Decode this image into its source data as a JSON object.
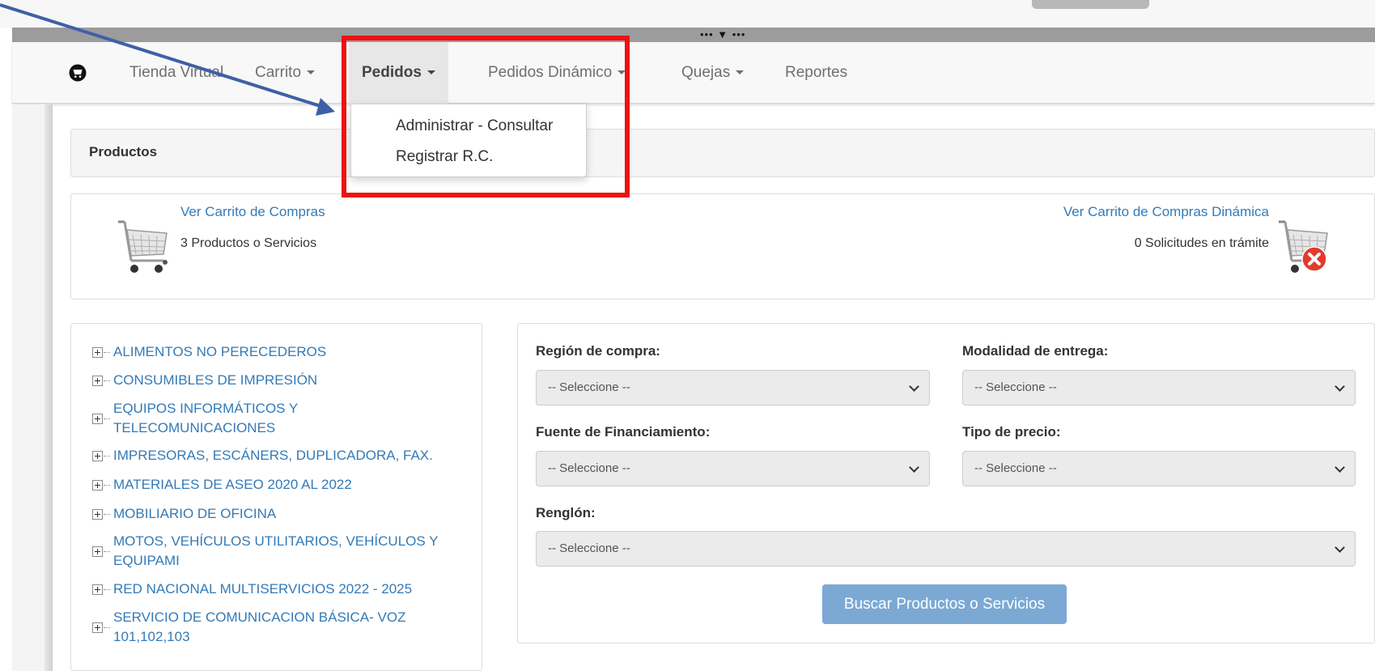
{
  "navbar": {
    "brand_icon": "cart-circle-icon",
    "items": [
      {
        "label": "Tienda Virtual",
        "caret": false
      },
      {
        "label": "Carrito",
        "caret": true
      },
      {
        "label": "Pedidos",
        "caret": true,
        "active": true
      },
      {
        "label": "Pedidos Dinámico",
        "caret": true
      },
      {
        "label": "Quejas",
        "caret": true
      },
      {
        "label": "Reportes",
        "caret": false
      }
    ]
  },
  "pedidos_menu": {
    "items": [
      "Administrar - Consultar",
      "Registrar R.C."
    ]
  },
  "products_panel": {
    "title": "Productos"
  },
  "cart": {
    "view_link": "Ver Carrito de Compras",
    "count_text": "3 Productos o Servicios",
    "dynamic_link": "Ver Carrito de Compras Dinámica",
    "dynamic_count_text": "0 Solicitudes en trámite"
  },
  "categories": [
    "ALIMENTOS NO PERECEDEROS",
    "CONSUMIBLES DE IMPRESIÓN",
    "EQUIPOS INFORMÁTICOS Y TELECOMUNICACIONES",
    "IMPRESORAS, ESCÁNERS, DUPLICADORA, FAX.",
    "MATERIALES DE ASEO 2020 AL 2022",
    "MOBILIARIO DE OFICINA",
    "MOTOS, VEHÍCULOS UTILITARIOS, VEHÍCULOS Y EQUIPAMI",
    "RED NACIONAL MULTISERVICIOS 2022 - 2025",
    "SERVICIO DE COMUNICACION BÁSICA- VOZ 101,102,103"
  ],
  "filters": {
    "region_label": "Región de compra:",
    "region_value": "-- Seleccione --",
    "modalidad_label": "Modalidad de entrega:",
    "modalidad_value": "-- Seleccione --",
    "fuente_label": "Fuente de Financiamiento:",
    "fuente_value": "-- Seleccione --",
    "precio_label": "Tipo de precio:",
    "precio_value": "-- Seleccione --",
    "renglon_label": "Renglón:",
    "renglon_value": "-- Seleccione --",
    "search_button": "Buscar Productos o Servicios"
  },
  "colors": {
    "link": "#337ab7",
    "highlight_box": "#ee1111",
    "annotation_arrow": "#3f5fa8",
    "search_button": "#7ba9d4"
  }
}
